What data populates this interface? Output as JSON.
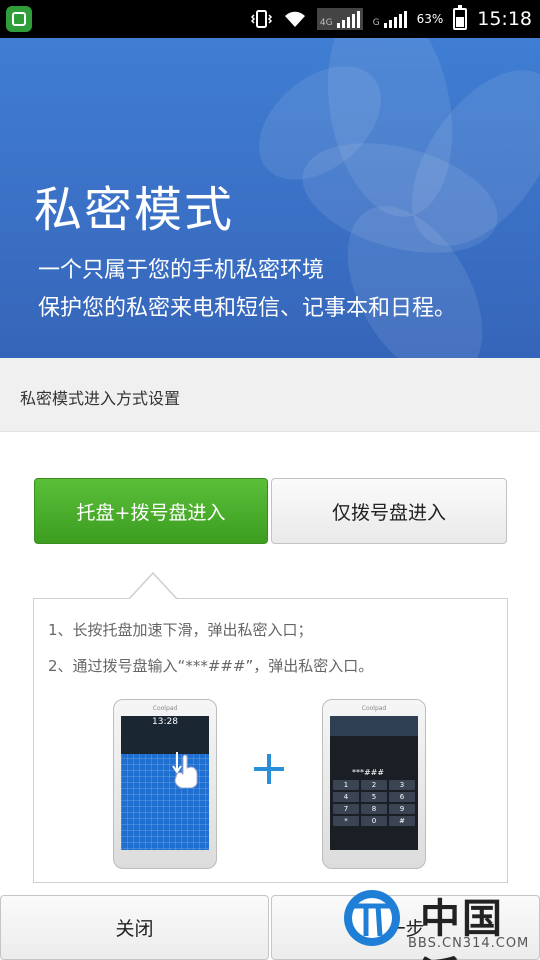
{
  "status_bar": {
    "network_type": "4G",
    "sim2_label": "G",
    "battery_percent": "63%",
    "battery_level": 0.63,
    "time": "15:18"
  },
  "hero": {
    "title": "私密模式",
    "line1": "一个只属于您的手机私密环境",
    "line2": "保护您的私密来电和短信、记事本和日程。"
  },
  "section": {
    "title": "私密模式进入方式设置"
  },
  "modes": {
    "tray_dial_label": "托盘+拨号盘进入",
    "dial_only_label": "仅拨号盘进入",
    "selected": "tray_dial"
  },
  "instructions": {
    "step1": "1、长按托盘加速下滑，弹出私密入口；",
    "step2": "2、通过拨号盘输入“***###”，弹出私密入口。"
  },
  "illustration": {
    "phone_brand": "Coolpad",
    "tray_time": "13:28",
    "dial_input": "***###",
    "keypad": [
      "1",
      "2",
      "3",
      "4",
      "5",
      "6",
      "7",
      "8",
      "9",
      "*",
      "0",
      "#"
    ]
  },
  "footer": {
    "close_label": "关闭",
    "next_label": "一步"
  },
  "watermark": {
    "brand": "中国派",
    "url": "BBS.CN314.COM"
  },
  "colors": {
    "accent_green": "#4caf2f",
    "hero_blue": "#3a6fc4",
    "plus_blue": "#2b8fd8"
  }
}
